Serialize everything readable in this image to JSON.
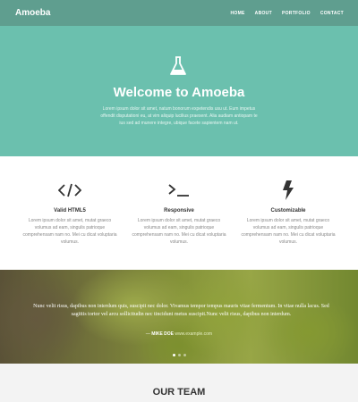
{
  "navbar": {
    "brand": "Amoeba",
    "links": [
      "HOME",
      "ABOUT",
      "PORTFOLIO",
      "CONTACT"
    ]
  },
  "hero": {
    "icon": "flask-icon",
    "title": "Welcome to Amoeba",
    "text": "Lorem ipsum dolor sit amet, natum bonorum expetendis usu ut. Eum impetus offendit disputationi eu, at vim aliquip lucilius praesent. Alia audiam antiopam te ius sed ad munere integre, ubique facete sapientem nam ut."
  },
  "features": [
    {
      "icon": "code-icon",
      "title": "Valid HTML5",
      "text": "Lorem ipsum dolor sit amet, mutat graeco volumus ad eam, singulis patrioque comprehensam nam no. Mei cu dicat voluptaria volumus."
    },
    {
      "icon": "terminal-icon",
      "title": "Responsive",
      "text": "Lorem ipsum dolor sit amet, mutat graeco volumus ad eam, singulis patrioque comprehensam nam no. Mei cu dicat voluptaria volumus."
    },
    {
      "icon": "lightning-icon",
      "title": "Customizable",
      "text": "Lorem ipsum dolor sit amet, mutat graeco volumus ad eam, singulis patrioque comprehensam nam no. Mei cu dicat voluptaria volumus."
    }
  ],
  "testimonial": {
    "quote": "Nunc velit risus, dapibus non interdum quis, suscipit nec dolor. Vivamus tempor tempus mauris vitae fermentum. In vitae nulla lacus. Sed sagittis tortor vel arcu sollicitudin nec tincidunt metus suscipit.Nunc velit risus, dapibus non interdum.",
    "author": "MIKE DOE",
    "author_site": "www.example.com",
    "slides": 3,
    "active_slide": 0
  },
  "team": {
    "title": "OUR TEAM"
  },
  "colors": {
    "nav": "#5f9e8f",
    "hero": "#6bc0ae",
    "team_bg": "#f3f3f3"
  }
}
